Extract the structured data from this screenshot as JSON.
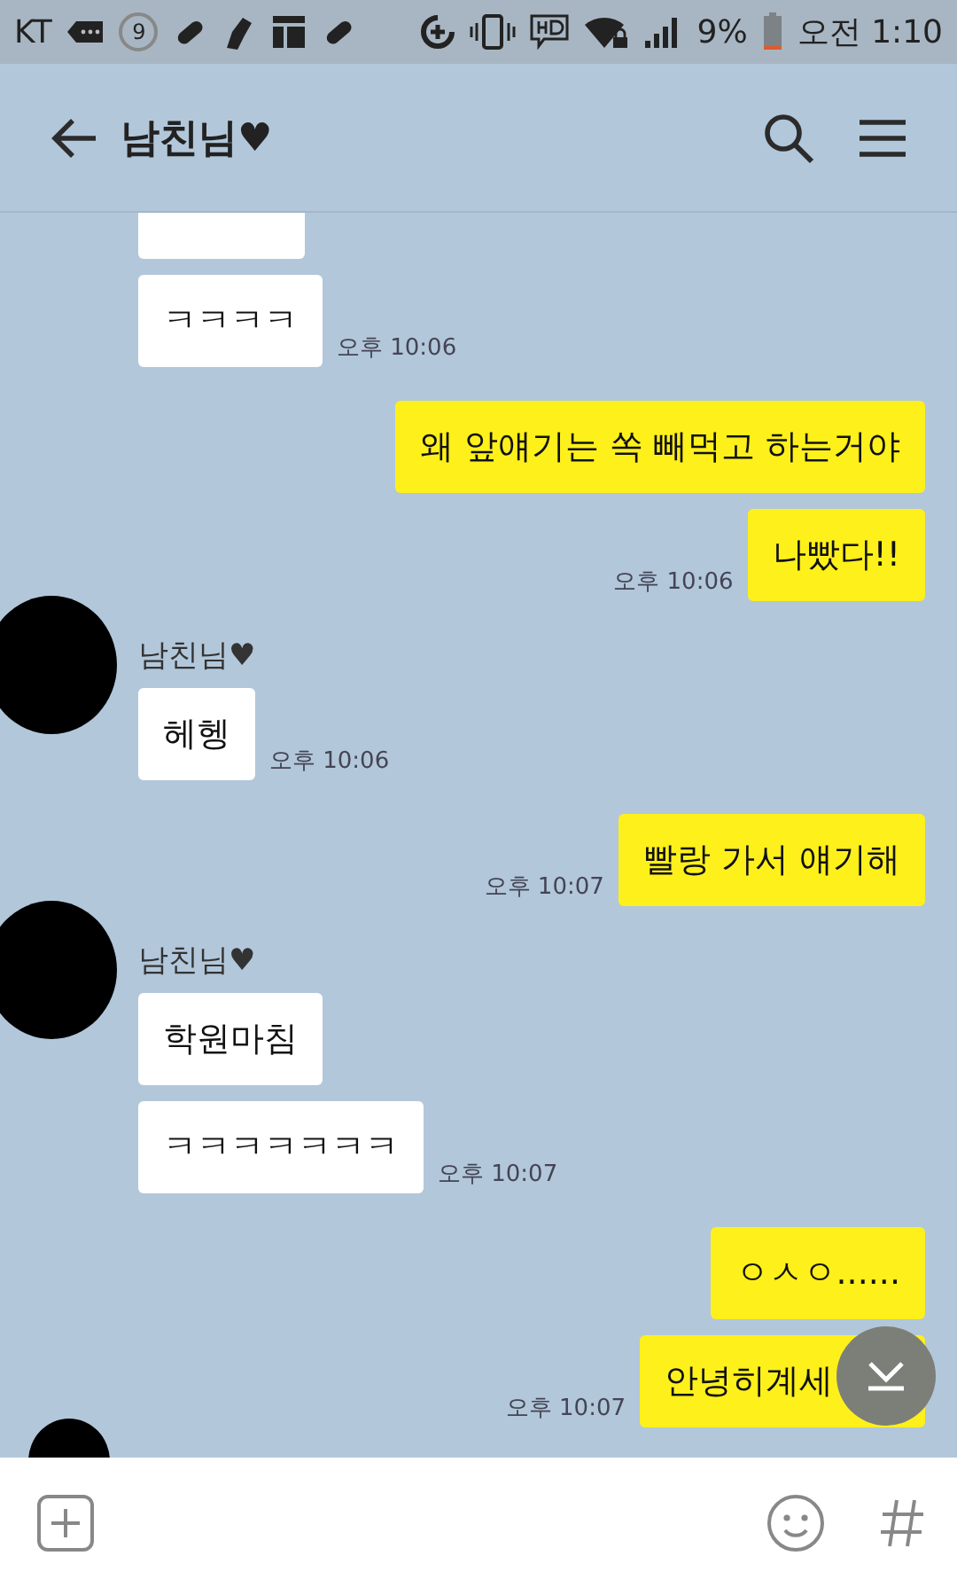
{
  "status_bar": {
    "carrier": "KT",
    "notification_count": "9",
    "battery_text": "9%",
    "time": "오전 1:10"
  },
  "header": {
    "title": "남친님♥"
  },
  "groups": [
    {
      "kind": "received",
      "messages": [
        {
          "kind": "clipped"
        },
        {
          "kind": "text",
          "text": "ㅋㅋㅋㅋ",
          "time": "오후 10:06"
        }
      ]
    },
    {
      "kind": "sent",
      "messages": [
        {
          "kind": "text",
          "text": "왜 앞얘기는 쏙 빼먹고 하는거야"
        },
        {
          "kind": "text",
          "text": "나빴다!!",
          "time": "오후 10:06"
        }
      ]
    },
    {
      "kind": "received",
      "sender": "남친님♥",
      "messages": [
        {
          "kind": "text",
          "text": "헤헹",
          "time": "오후 10:06"
        }
      ]
    },
    {
      "kind": "sent",
      "messages": [
        {
          "kind": "text",
          "text": "빨랑 가서 얘기해",
          "time": "오후 10:07"
        }
      ]
    },
    {
      "kind": "received",
      "sender": "남친님♥",
      "messages": [
        {
          "kind": "text",
          "text": "학원마침"
        },
        {
          "kind": "text",
          "text": "ㅋㅋㅋㅋㅋㅋㅋ",
          "time": "오후 10:07"
        }
      ]
    },
    {
      "kind": "sent",
      "messages": [
        {
          "kind": "text",
          "text": "ㅇㅅㅇ......"
        },
        {
          "kind": "text",
          "text": "안녕히계세",
          "time": "오후 10:07"
        }
      ]
    }
  ]
}
